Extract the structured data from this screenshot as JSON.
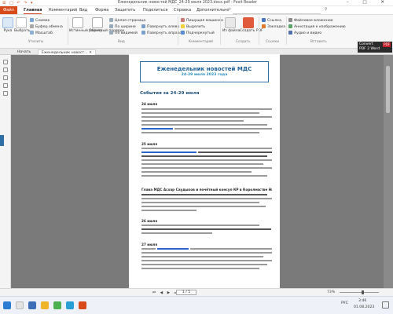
{
  "window": {
    "quick_access": "☰ □ ↶ ↷ ▾",
    "title": "Еженедельник новостей МДС_24-29 июля 2023.docx.pdf - Foxit Reader",
    "controls": "– □ ✕"
  },
  "menu": {
    "file": "Файл",
    "tabs": [
      "Главная",
      "Комментарий",
      "Вид",
      "Форма",
      "Защитить",
      "Поделиться",
      "Справка",
      "Дополнительно"
    ],
    "search_placeholder": "Расскажите, что хотите сделать"
  },
  "ribbon": {
    "hand_label": "Рука",
    "select_label": "Выбрать",
    "snapshot": "Снимок",
    "clipboard": "Буфер обмена",
    "zoom": "Масштаб",
    "actual_size": "Истинный размер",
    "reverse_order": "Обратный порядок",
    "fit_page": "Целая страница",
    "fit_width": "По ширине",
    "fit_visible": "По видимой",
    "rotate_left": "Повернуть влево",
    "rotate_right": "Повернуть вправо",
    "typewriter": "Пишущая машинка",
    "highlight": "Выделить",
    "underline": "Подчеркнутый",
    "from_file": "Из файла",
    "create_pdf": "Создать PDF",
    "link": "Ссылка",
    "bookmark": "Закладка",
    "file_attach": "Файловое вложение",
    "image_annot": "Аннотация к изображению",
    "audio_video": "Аудио и видео",
    "groups": [
      "Утилиты",
      "Вид",
      "Комментарий",
      "Создать",
      "Ссылки",
      "Вставить"
    ]
  },
  "tabs": {
    "start": "Начать",
    "document": "Еженедельник новост... ✕"
  },
  "document": {
    "banner_title": "Еженедельник новостей МДС",
    "banner_date": "24-29 июля 2023 года",
    "section_title": "События за 24-29 июля",
    "news": [
      {
        "date": "24 июля"
      },
      {
        "date": "25 июля"
      },
      {
        "date": "Глава МДС Асхар Саудыков и почётный консул КР в Королевстве Нидерланды"
      },
      {
        "date": "26 июля"
      },
      {
        "date": "27 июля"
      }
    ]
  },
  "badge": {
    "line1": "Convert",
    "line2": "PDF 2 Word",
    "tag": "PDF"
  },
  "status": {
    "page": "1 / 5",
    "zoom": "73%",
    "nav": "⏮ ◀ ▶ ⏭"
  },
  "taskbar": {
    "lang": "РУС",
    "time": "3:46",
    "date": "01.08.2023"
  },
  "colors": {
    "accent": "#d94a1b",
    "doc_blue": "#1d5f98",
    "link_blue": "#2b63c8"
  }
}
